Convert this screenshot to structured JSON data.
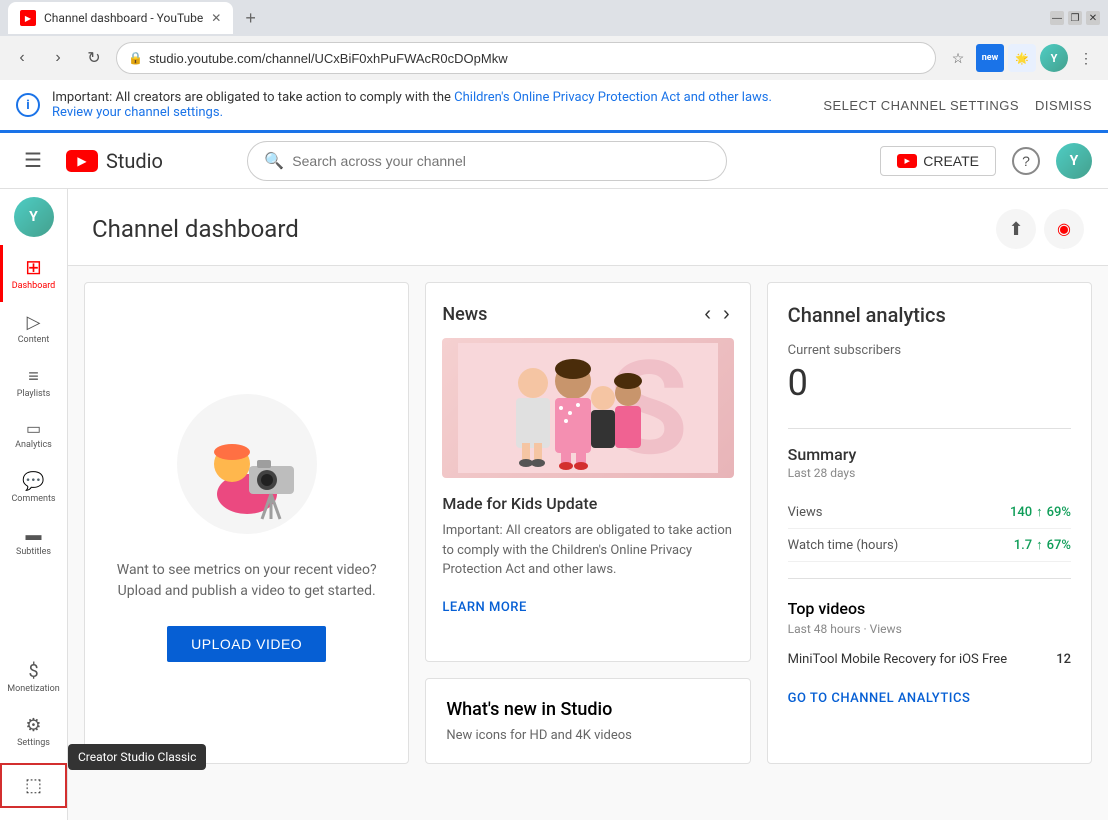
{
  "browser": {
    "tab_title": "Channel dashboard - YouTube",
    "url": "studio.youtube.com/channel/UCxBiF0xhPuFWAcR0cDOpMkw",
    "new_tab_label": "+",
    "window_controls": [
      "—",
      "❐",
      "✕"
    ]
  },
  "notification": {
    "info_symbol": "i",
    "text_part1": "Important: All creators are obligated to take action to comply with the ",
    "link_text": "Children's Online Privacy Protection Act and other laws. Review your channel settings.",
    "select_btn": "SELECT CHANNEL SETTINGS",
    "dismiss_btn": "DISMISS"
  },
  "topnav": {
    "menu_icon": "☰",
    "logo_text": "Studio",
    "search_placeholder": "Search across your channel",
    "create_label": "CREATE",
    "help_icon": "?",
    "avatar_text": "Y"
  },
  "sidebar": {
    "avatar_text": "Y",
    "items": [
      {
        "id": "dashboard",
        "icon": "⊞",
        "label": "Dashboard",
        "active": true
      },
      {
        "id": "content",
        "icon": "▷",
        "label": "Content"
      },
      {
        "id": "playlists",
        "icon": "≡",
        "label": "Playlists"
      },
      {
        "id": "analytics",
        "icon": "▭",
        "label": "Analytics"
      },
      {
        "id": "comments",
        "icon": "💬",
        "label": "Comments"
      },
      {
        "id": "subtitles",
        "icon": "▬",
        "label": "Subtitles"
      },
      {
        "id": "monetization",
        "icon": "$",
        "label": "Monetization"
      },
      {
        "id": "settings",
        "icon": "⚙",
        "label": "Settings"
      }
    ],
    "creator_classic_label": "Creator Studio Classic",
    "exit_icon": "⬚"
  },
  "main": {
    "title": "Channel dashboard",
    "upload_icon": "⬆",
    "live_icon": "◉"
  },
  "upload_card": {
    "text": "Want to see metrics on your recent video? Upload and publish a video to get started.",
    "button_label": "UPLOAD VIDEO"
  },
  "news_card": {
    "title": "News",
    "prev_icon": "‹",
    "next_icon": "›",
    "article_title": "Made for Kids Update",
    "article_text": "Important: All creators are obligated to take action to comply with the Children's Online Privacy Protection Act and other laws.",
    "learn_more": "LEARN MORE"
  },
  "news_card2": {
    "title": "What's new in Studio",
    "text": "New icons for HD and 4K videos"
  },
  "analytics": {
    "title": "Channel analytics",
    "subscribers_label": "Current subscribers",
    "subscribers_count": "0",
    "summary_title": "Summary",
    "summary_period": "Last 28 days",
    "metrics": [
      {
        "label": "Views",
        "value": "140",
        "change": "↑ 69%"
      },
      {
        "label": "Watch time (hours)",
        "value": "1.7",
        "change": "↑ 67%"
      }
    ],
    "top_videos_title": "Top videos",
    "top_videos_period": "Last 48 hours · Views",
    "top_videos": [
      {
        "name": "MiniTool Mobile Recovery for iOS Free",
        "count": "12"
      }
    ],
    "analytics_link": "GO TO CHANNEL ANALYTICS"
  }
}
